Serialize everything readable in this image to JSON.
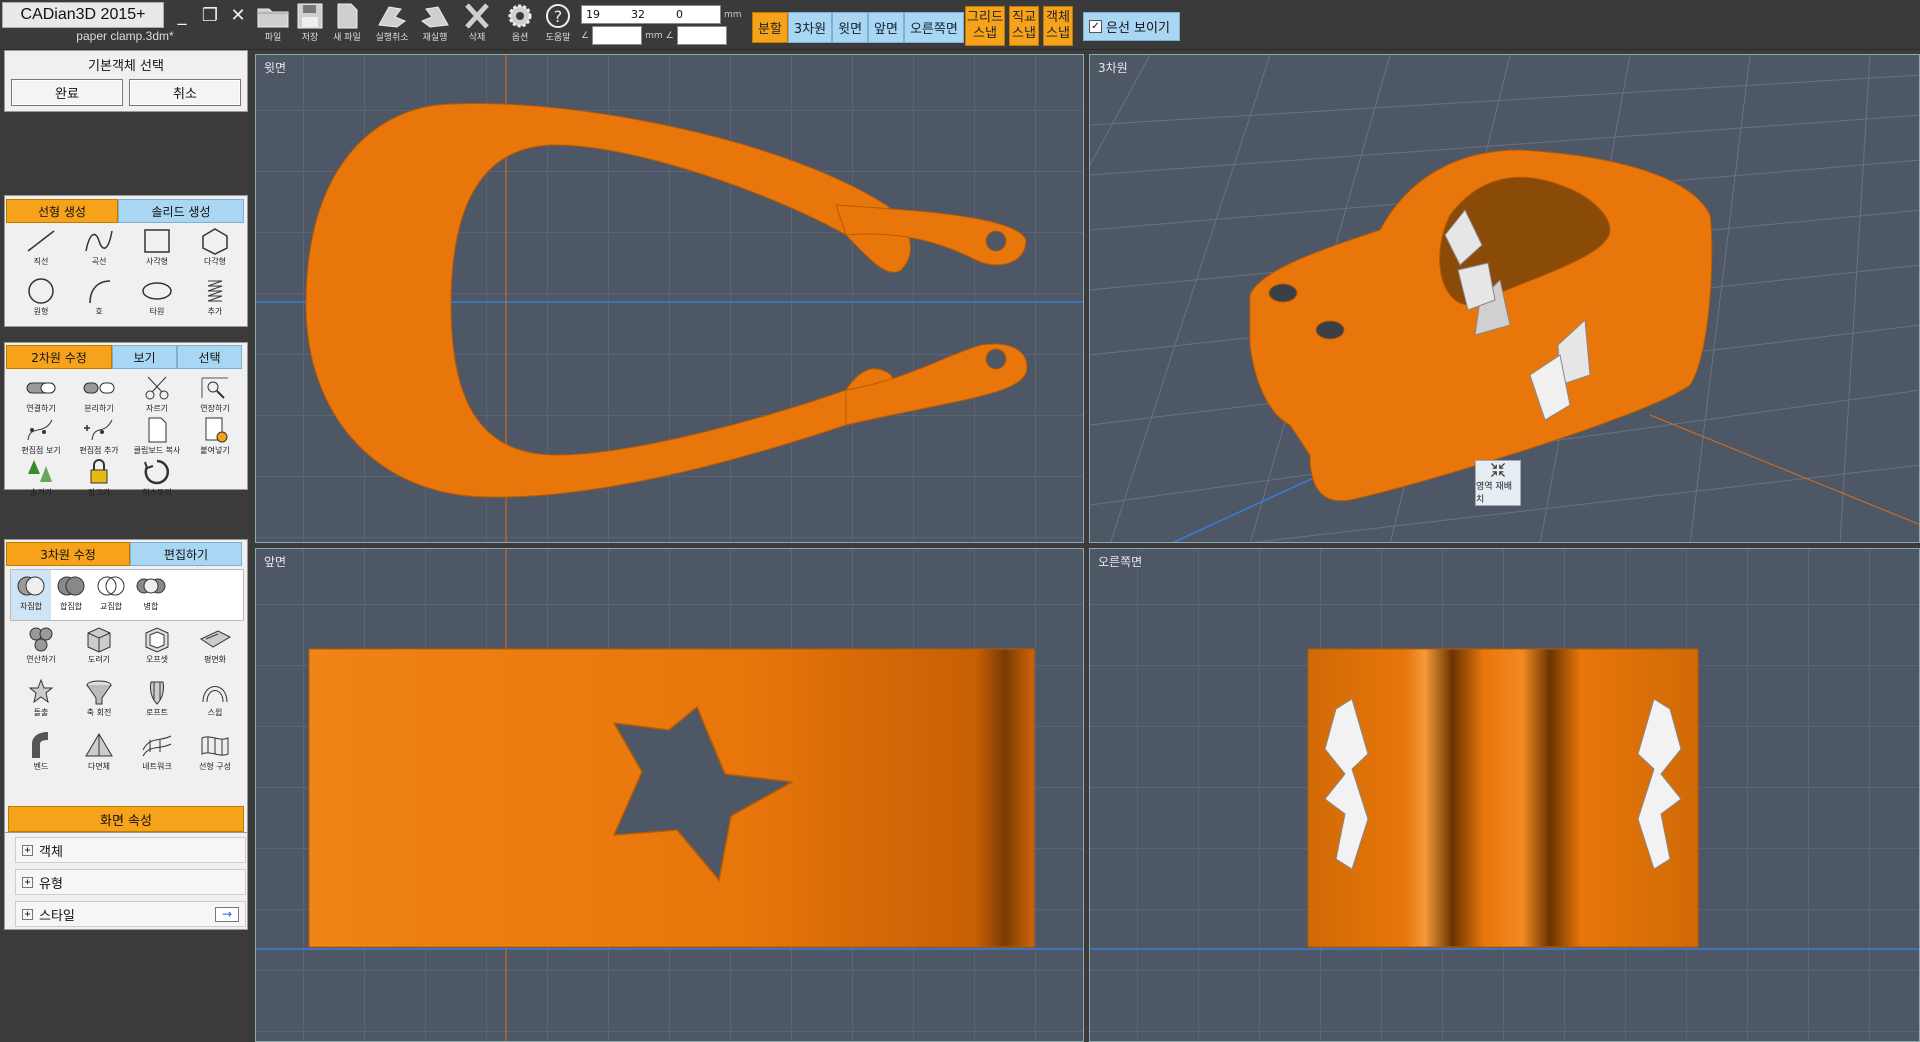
{
  "app": {
    "title": "CADian3D 2015+",
    "file_name": "paper clamp.3dm*"
  },
  "window": {
    "minimize": "_",
    "restore": "❐",
    "close": "✕"
  },
  "toolbar": [
    {
      "label": "파일",
      "icon": "folder-icon"
    },
    {
      "label": "저장",
      "icon": "floppy-icon"
    },
    {
      "label": "새 파일",
      "icon": "new-file-icon"
    },
    {
      "label": "실행취소",
      "icon": "undo-icon"
    },
    {
      "label": "재실행",
      "icon": "redo-icon"
    },
    {
      "label": "삭제",
      "icon": "delete-x-icon"
    },
    {
      "label": "옵션",
      "icon": "gear-icon"
    },
    {
      "label": "도움말",
      "icon": "help-icon"
    }
  ],
  "coords": {
    "x": "19",
    "y": "32",
    "z": "0",
    "unit": "mm",
    "unit2": "mm",
    "angle_symbol": "∠",
    "angle_symbol2": "∠"
  },
  "view_buttons": {
    "split": "분할",
    "view3d": "3차원",
    "top": "윗면",
    "front": "앞면",
    "right": "오른쪽면"
  },
  "snaps": {
    "grid": "그리드\n스냅",
    "ortho": "직교\n스냅",
    "object": "객체\n스냅"
  },
  "hidden_line": {
    "label": "은선 보이기",
    "checked": true
  },
  "select_panel": {
    "title": "기본객체 선택",
    "done": "완료",
    "cancel": "취소"
  },
  "create_tabs": {
    "line": "선형 생성",
    "solid": "솔리드 생성"
  },
  "create_tools": [
    "직선",
    "곡선",
    "사각형",
    "다각형",
    "원형",
    "호",
    "타원",
    "추가"
  ],
  "edit2d_tabs": {
    "edit": "2차원 수정",
    "view": "보기",
    "select": "선택"
  },
  "edit2d_tools": [
    "연결하기",
    "분리하기",
    "자르기",
    "연장하기",
    "편집점 보기",
    "편집점 추가",
    "클립보드 복사",
    "붙여넣기",
    "숨기기",
    "잠그기",
    "히스토리"
  ],
  "edit3d_tabs": {
    "edit": "3차원 수정",
    "modify": "편집하기"
  },
  "boolean_tools": [
    "차집합",
    "합집합",
    "교집합",
    "병합"
  ],
  "edit3d_tools": [
    "연산하기",
    "도려기",
    "오프셋",
    "평면화",
    "돌출",
    "축 회전",
    "로프트",
    "스윕",
    "벤드",
    "다면체",
    "네트워크",
    "선형 구성"
  ],
  "properties": {
    "header": "화면 속성",
    "rows": [
      "객체",
      "유형",
      "스타일"
    ],
    "style_arrow": "→"
  },
  "viewports": {
    "top": "윗면",
    "view3d": "3차원",
    "front": "앞면",
    "right": "오른쪽면"
  },
  "region_button": {
    "label": "영역 재배치"
  },
  "colors": {
    "orange": "#e8760a",
    "accent": "#f6a31b",
    "tab_blue": "#a9d6f2",
    "viewport_bg": "#4e5766"
  }
}
